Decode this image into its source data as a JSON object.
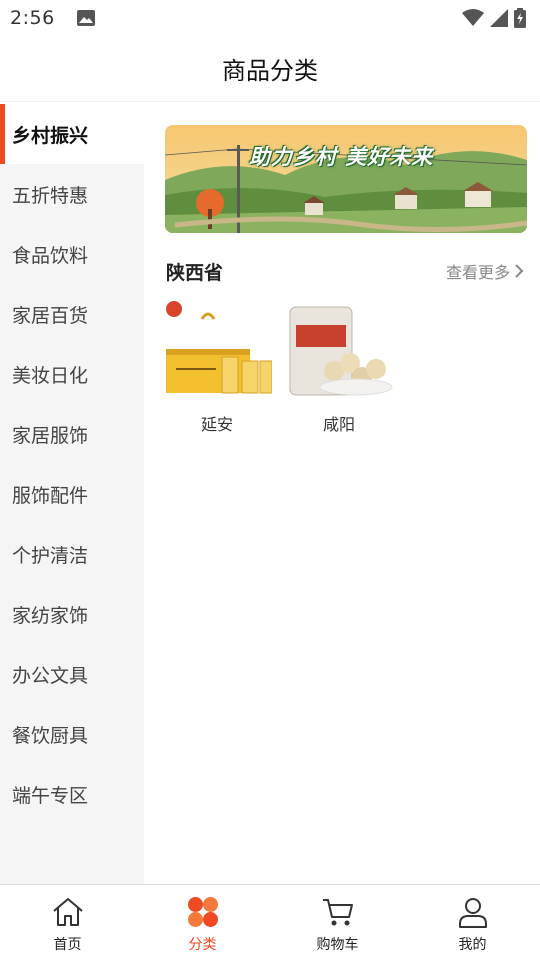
{
  "status_bar": {
    "time": "2:56",
    "icons": [
      "image-icon",
      "wifi-icon",
      "signal-icon",
      "battery-charging-icon"
    ]
  },
  "header": {
    "title": "商品分类"
  },
  "sidebar": {
    "items": [
      {
        "label": "乡村振兴",
        "active": true
      },
      {
        "label": "五折特惠"
      },
      {
        "label": "食品饮料"
      },
      {
        "label": "家居百货"
      },
      {
        "label": "美妆日化"
      },
      {
        "label": "家居服饰"
      },
      {
        "label": "服饰配件"
      },
      {
        "label": "个护清洁"
      },
      {
        "label": "家纺家饰"
      },
      {
        "label": "办公文具"
      },
      {
        "label": "餐饮厨具"
      },
      {
        "label": "端午专区"
      }
    ]
  },
  "content": {
    "banner": {
      "text": "助力乡村 美好未来"
    },
    "section": {
      "title": "陕西省",
      "more": "查看更多"
    },
    "products": [
      {
        "name": "延安"
      },
      {
        "name": "咸阳"
      }
    ]
  },
  "tabbar": {
    "tabs": [
      {
        "label": "首页",
        "icon": "home-icon"
      },
      {
        "label": "分类",
        "icon": "category-icon",
        "active": true
      },
      {
        "label": "购物车",
        "icon": "cart-icon"
      },
      {
        "label": "我的",
        "icon": "user-icon"
      }
    ]
  },
  "colors": {
    "accent": "#f04a23",
    "sidebar_bg": "#f5f5f5"
  }
}
